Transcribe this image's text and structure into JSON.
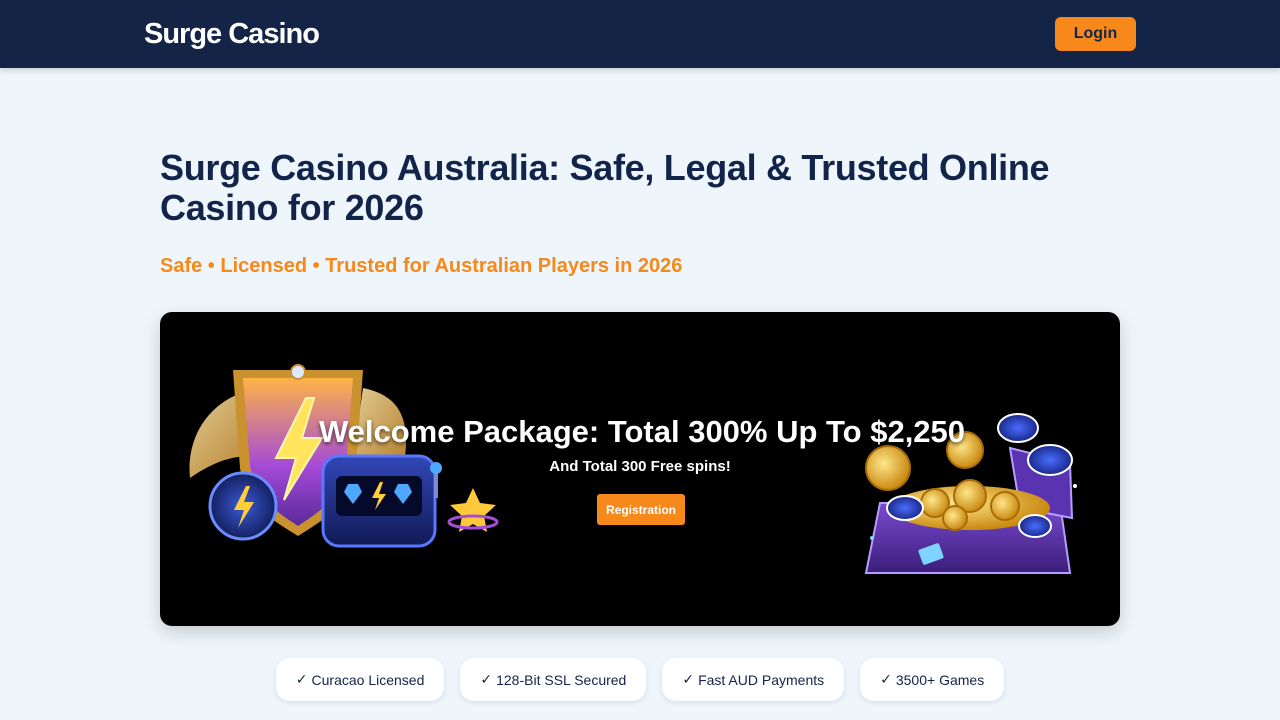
{
  "header": {
    "brand": "Surge Casino",
    "login_label": "Login"
  },
  "hero": {
    "title": "Surge Casino Australia: Safe, Legal & Trusted Online Casino for 2026",
    "subtitle": "Safe • Licensed • Trusted for Australian Players in 2026"
  },
  "banner": {
    "headline": "Welcome Package: Total 300% Up To $2,250",
    "subheadline": "And Total 300 Free spins!",
    "cta_label": "Registration",
    "left_art": "winged-shield-slot-machine-illustration",
    "right_art": "treasure-chest-coins-illustration"
  },
  "features": [
    {
      "check": "✓",
      "label": "Curacao Licensed"
    },
    {
      "check": "✓",
      "label": "128-Bit SSL Secured"
    },
    {
      "check": "✓",
      "label": "Fast AUD Payments"
    },
    {
      "check": "✓",
      "label": "3500+ Games"
    }
  ],
  "colors": {
    "navy": "#132447",
    "accent_orange": "#f7881a",
    "page_bg": "#eef6fc",
    "banner_bg": "#000000"
  }
}
